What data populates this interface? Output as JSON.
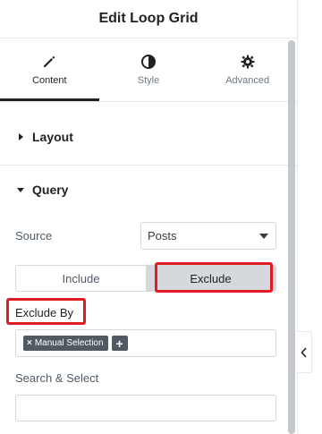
{
  "header": {
    "title": "Edit Loop Grid"
  },
  "tabs": [
    {
      "label": "Content",
      "icon": "pencil-icon",
      "active": true
    },
    {
      "label": "Style",
      "icon": "contrast-icon",
      "active": false
    },
    {
      "label": "Advanced",
      "icon": "gear-icon",
      "active": false
    }
  ],
  "sections": {
    "layout": {
      "label": "Layout",
      "expanded": false
    },
    "query": {
      "label": "Query",
      "expanded": true
    }
  },
  "query": {
    "source_label": "Source",
    "source_value": "Posts",
    "toggle": {
      "include": "Include",
      "exclude": "Exclude",
      "selected": "exclude"
    },
    "exclude_by_label": "Exclude By",
    "exclude_by_chips": [
      "Manual Selection"
    ],
    "search_select_label": "Search & Select",
    "search_value": ""
  },
  "colors": {
    "highlight": "#e01b24",
    "chip": "#515962",
    "toggle_selected": "#d5d8dc"
  }
}
